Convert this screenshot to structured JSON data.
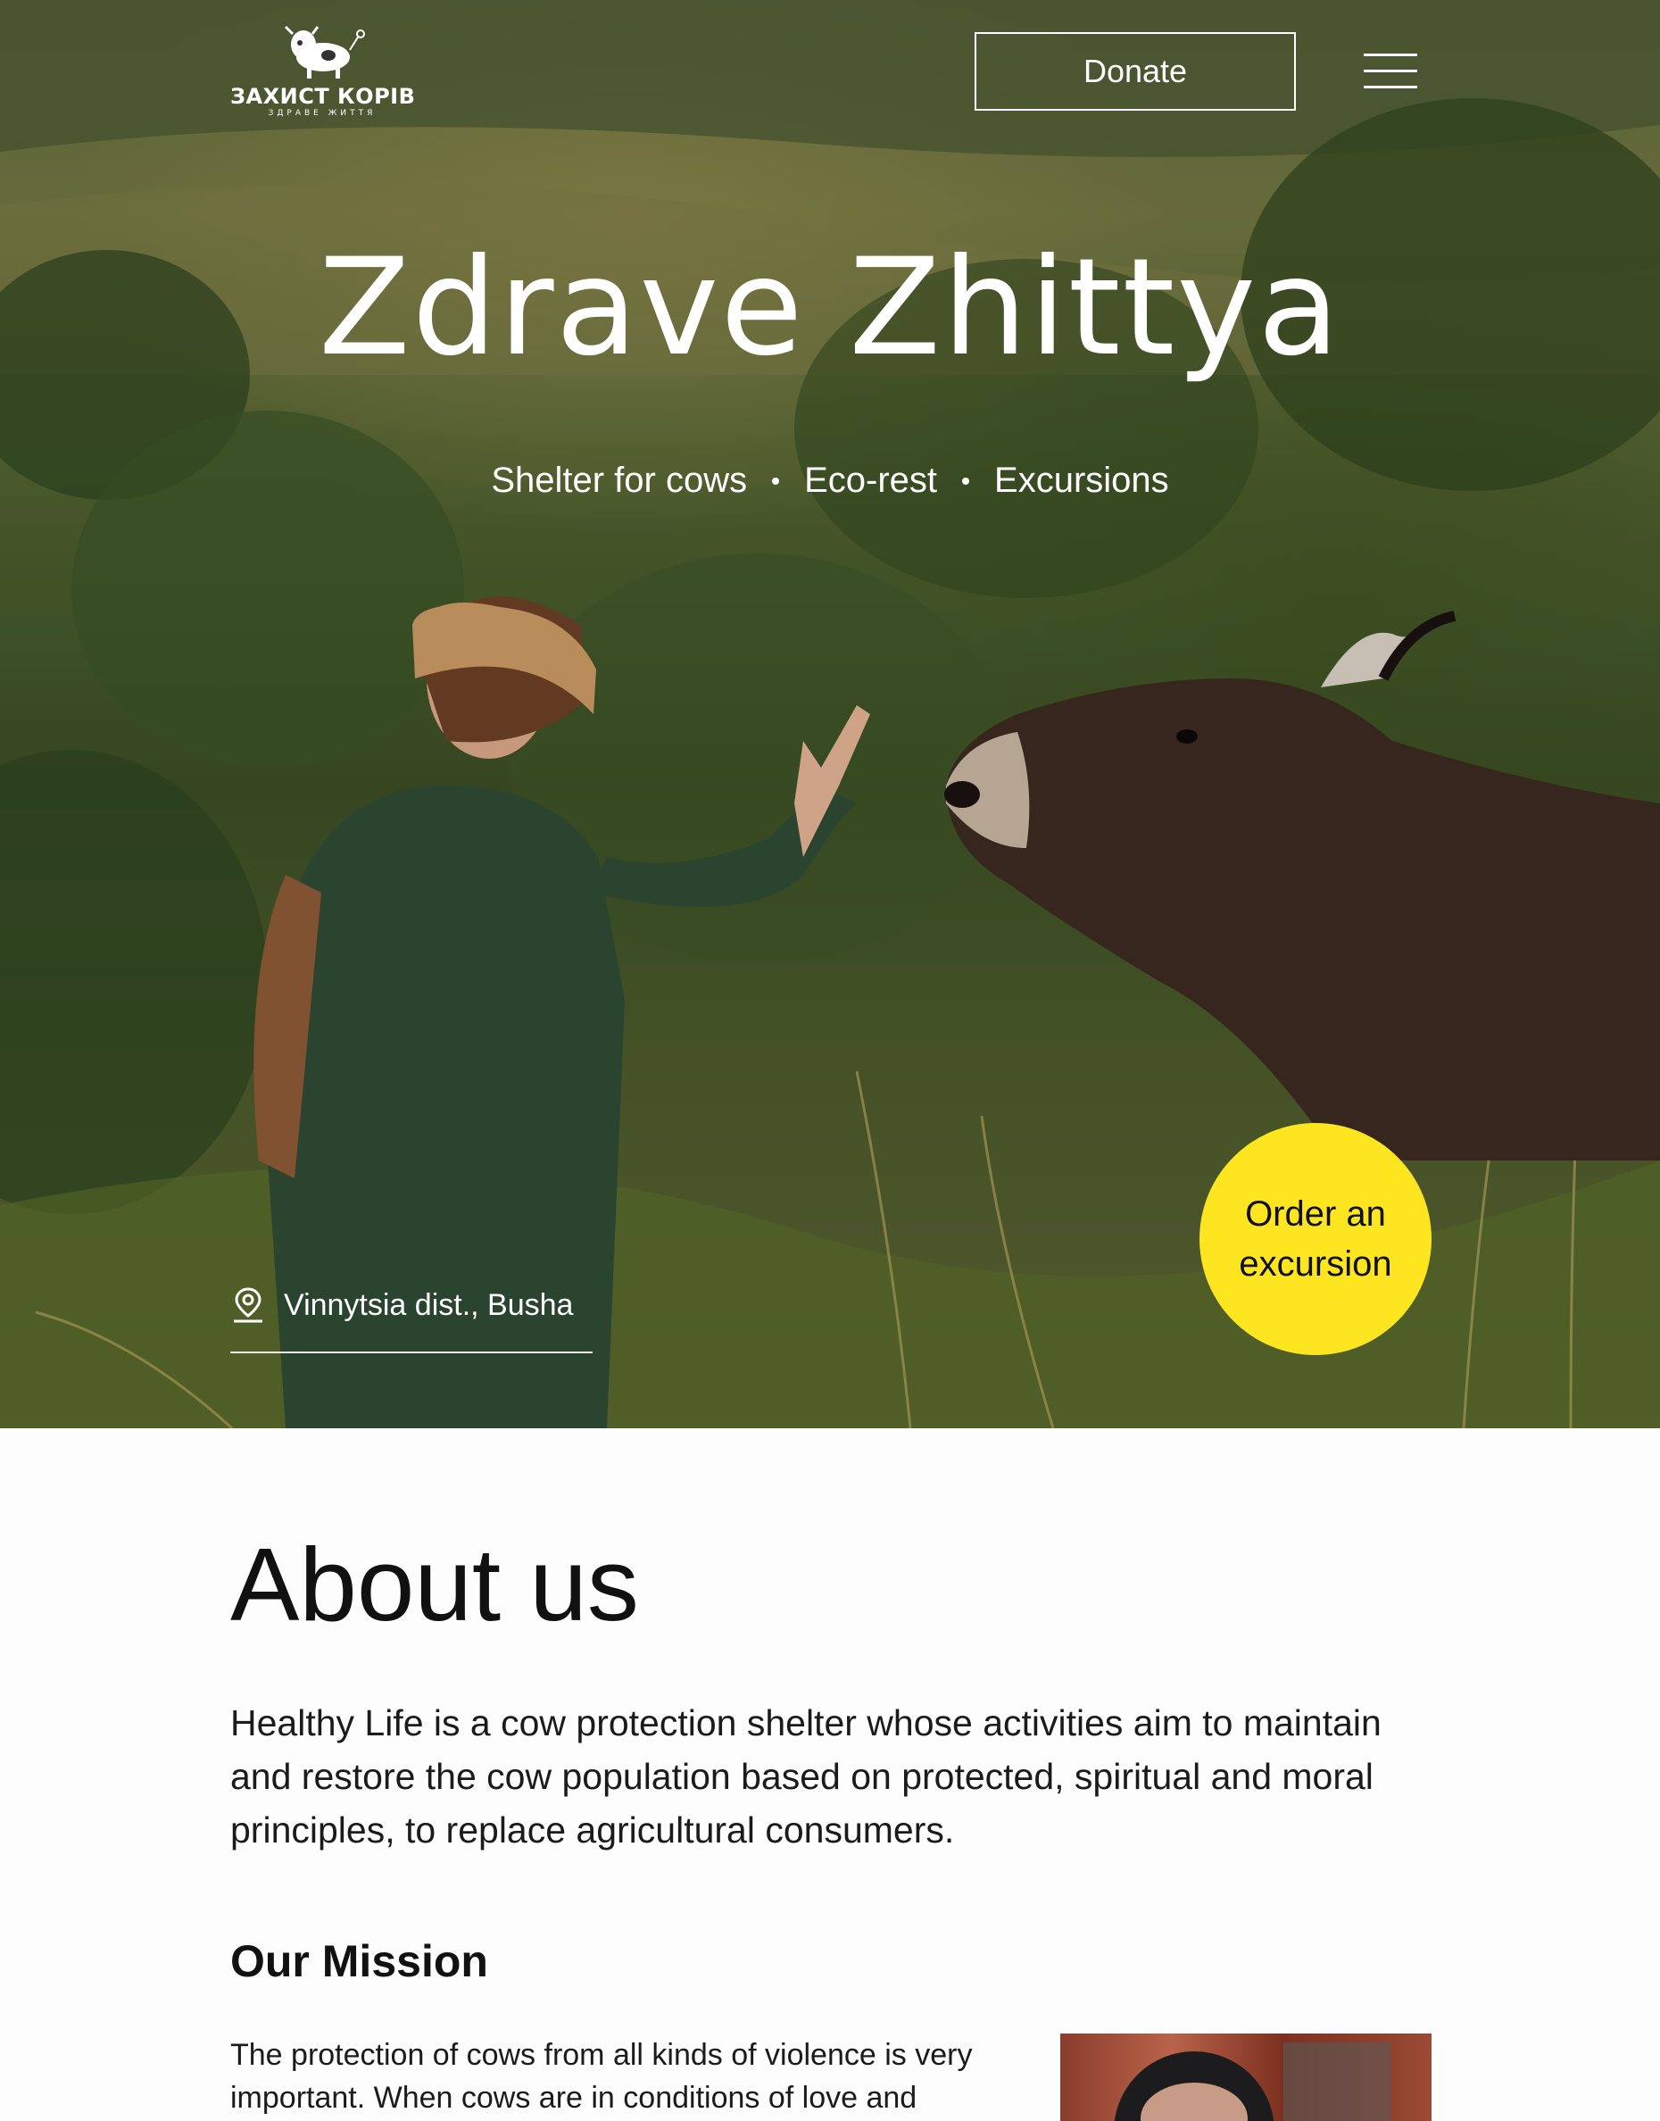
{
  "header": {
    "logo_text": "ЗАХИСТ КОРІВ",
    "logo_subtext": "ЗДРАВЕ ЖИТТЯ",
    "logo_icon": "cow-icon",
    "donate_label": "Donate",
    "menu_icon": "hamburger-menu-icon"
  },
  "hero": {
    "title": "Zdrave Zhittya",
    "tagline": [
      "Shelter for cows",
      "Eco-rest",
      "Excursions"
    ],
    "location": "Vinnytsia dist., Busha",
    "location_icon": "map-pin-icon",
    "order_label": "Order an excursion"
  },
  "about": {
    "title": "About us",
    "text": "Healthy Life is a cow protection shelter whose activities aim to maintain and restore the cow population based on protected, spiritual and moral principles, to replace agricultural consumers.",
    "mission_title": "Our Mission",
    "mission_text": "The protection of cows from all kinds of violence is very important. When cows are in conditions of love and"
  },
  "colors": {
    "accent": "#fde51f",
    "text": "#111111",
    "background": "#fdfdfd"
  }
}
